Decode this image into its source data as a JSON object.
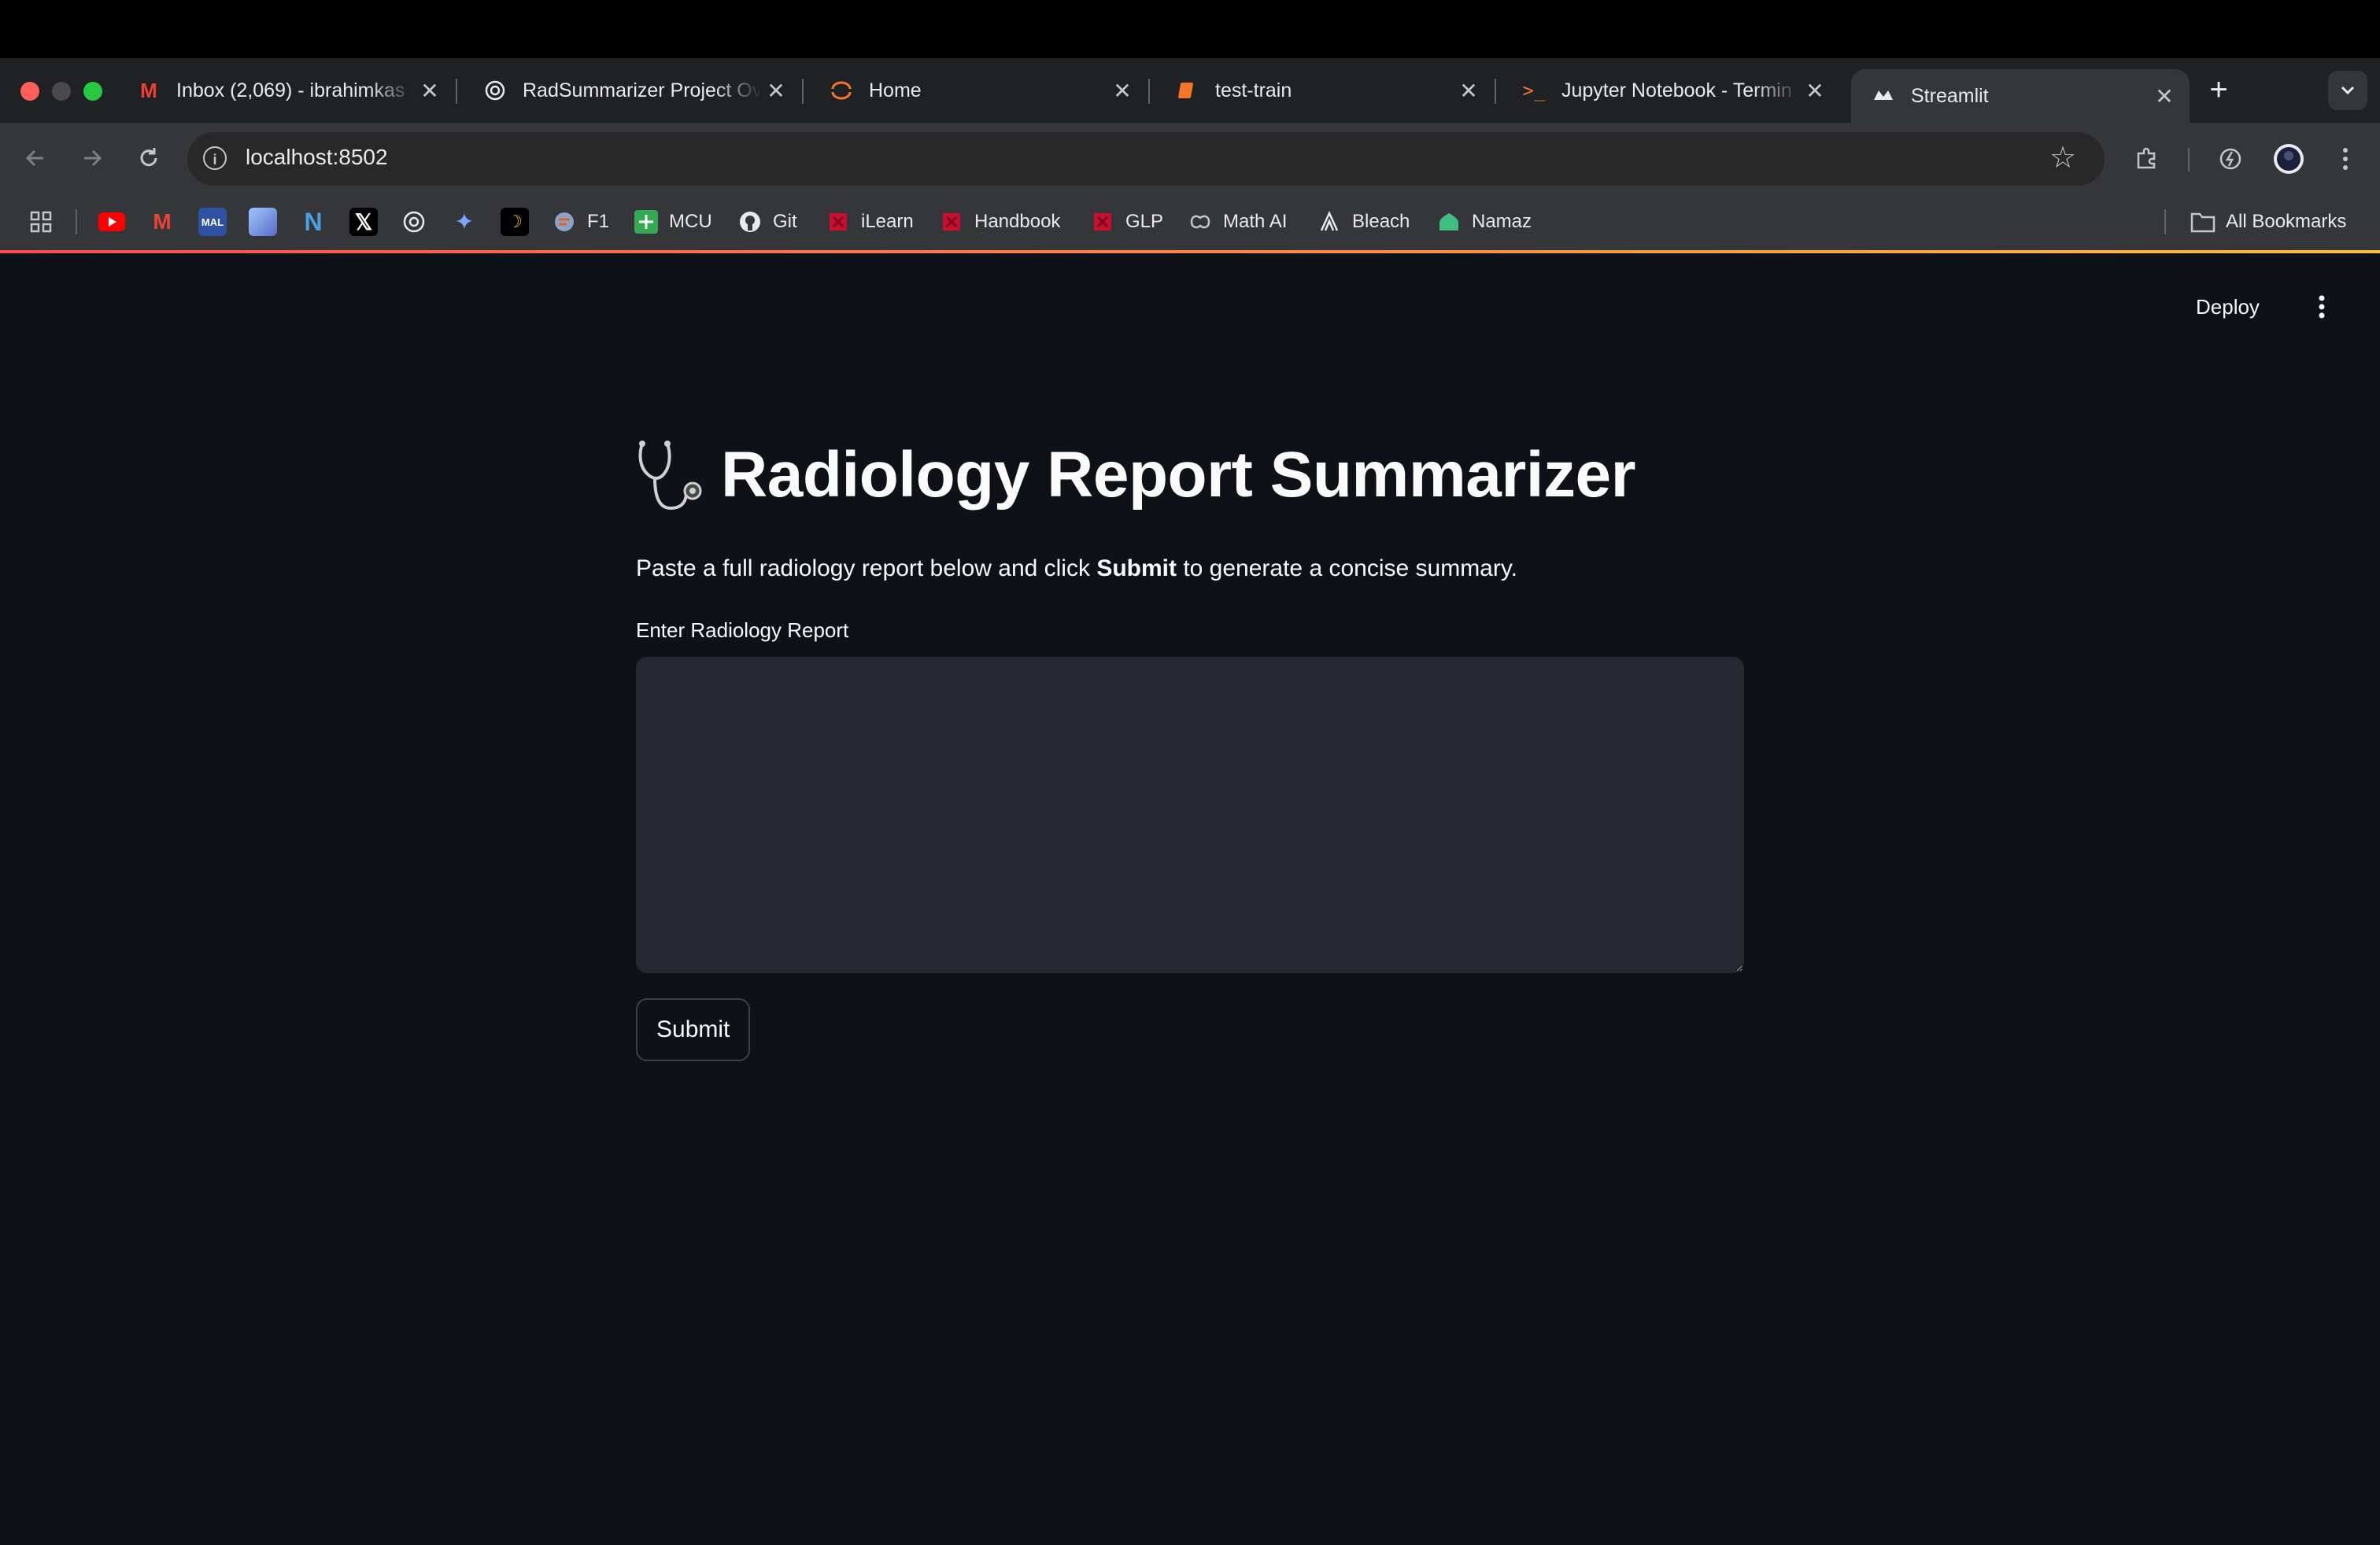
{
  "browser": {
    "tabs": [
      {
        "title": "Inbox (2,069) - ibrahimkas",
        "icon": "gmail-icon"
      },
      {
        "title": "RadSummarizer Project Ov",
        "icon": "openai-icon"
      },
      {
        "title": "Home",
        "icon": "jupyter-icon"
      },
      {
        "title": "test-train",
        "icon": "notebook-icon"
      },
      {
        "title": "Jupyter Notebook - Termin",
        "icon": "terminal-icon"
      },
      {
        "title": "Streamlit",
        "icon": "streamlit-icon",
        "active": true
      }
    ],
    "close_glyph": "✕",
    "new_tab_glyph": "+",
    "url": "localhost:8502",
    "bookmarks": [
      {
        "label": "F1",
        "icon": "f1-icon"
      },
      {
        "label": "MCU",
        "icon": "mcu-icon"
      },
      {
        "label": "Git",
        "icon": "github-icon"
      },
      {
        "label": "iLearn",
        "icon": "ilearn-icon"
      },
      {
        "label": "Handbook",
        "icon": "handbook-icon"
      },
      {
        "label": "GLP",
        "icon": "glp-icon"
      },
      {
        "label": "Math AI",
        "icon": "math-ai-icon"
      },
      {
        "label": "Bleach",
        "icon": "bleach-icon"
      },
      {
        "label": "Namaz",
        "icon": "namaz-icon"
      }
    ],
    "all_bookmarks": "All Bookmarks"
  },
  "app": {
    "deploy_label": "Deploy",
    "title": "Radiology Report Summarizer",
    "title_icon": "stethoscope-icon",
    "description_before": "Paste a full radiology report below and click ",
    "description_bold": "Submit",
    "description_after": " to generate a concise summary.",
    "input_label": "Enter Radiology Report",
    "input_value": "",
    "submit_label": "Submit"
  },
  "colors": {
    "background": "#0e1117",
    "input_bg": "#262730",
    "accent_gradient_start": "#ff4b4b",
    "accent_gradient_end": "#ffbd45"
  }
}
